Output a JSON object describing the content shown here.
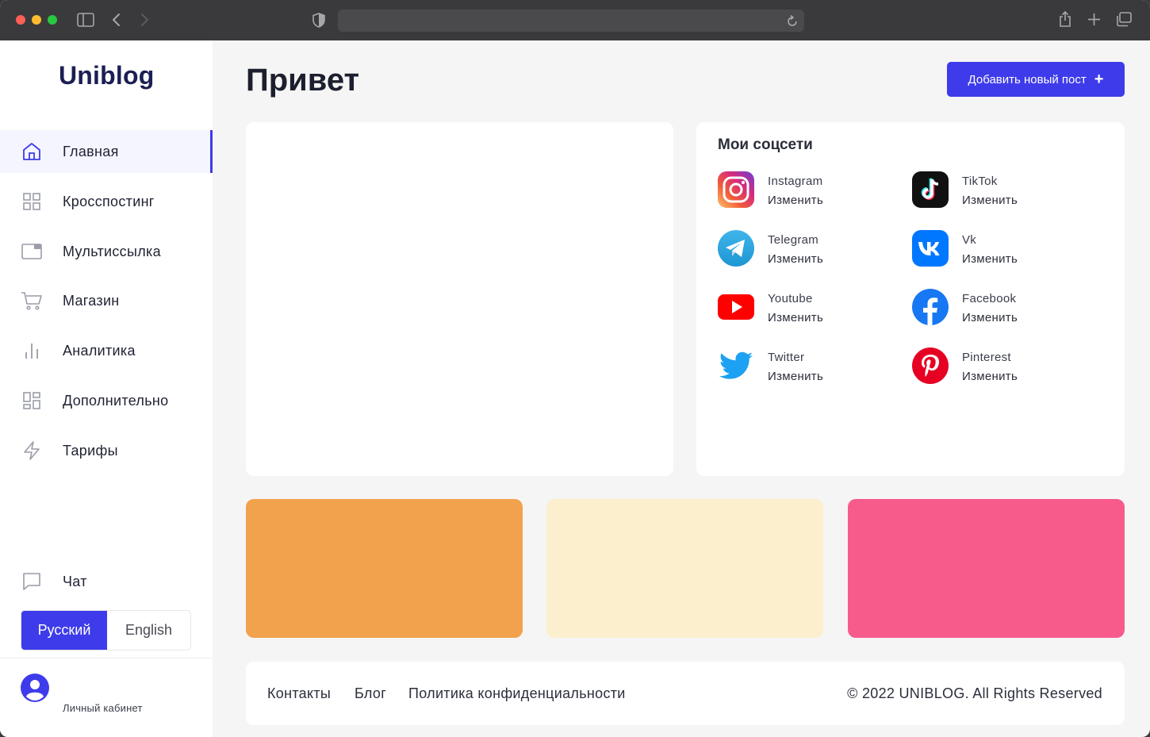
{
  "browser": {
    "window_controls": [
      "close",
      "minimize",
      "maximize"
    ],
    "icons": [
      "sidebar-toggle-icon",
      "back-icon",
      "forward-icon",
      "shield-icon",
      "reload-icon",
      "share-icon",
      "new-tab-icon",
      "tabs-overview-icon"
    ]
  },
  "sidebar": {
    "logo": "Uniblog",
    "items": [
      {
        "label": "Главная",
        "icon": "home-icon",
        "active": true
      },
      {
        "label": "Кросспостинг",
        "icon": "grid-icon"
      },
      {
        "label": "Мультиссылка",
        "icon": "browser-window-icon"
      },
      {
        "label": "Магазин",
        "icon": "cart-icon"
      },
      {
        "label": "Аналитика",
        "icon": "bar-chart-icon"
      },
      {
        "label": "Дополнительно",
        "icon": "dashboard-icon"
      },
      {
        "label": "Тарифы",
        "icon": "lightning-icon"
      }
    ],
    "chat": {
      "label": "Чат",
      "icon": "chat-icon"
    },
    "languages": {
      "ru": "Русский",
      "en": "English",
      "selected": "ru"
    },
    "account": {
      "label": "Личный кабинет",
      "icon": "user-avatar-icon"
    }
  },
  "main": {
    "title": "Привет",
    "add_post_label": "Добавить новый пост",
    "social": {
      "title": "Мои соцсети",
      "edit_label": "Изменить",
      "items": [
        {
          "name": "Instagram",
          "icon": "instagram-icon"
        },
        {
          "name": "TikTok",
          "icon": "tiktok-icon"
        },
        {
          "name": "Telegram",
          "icon": "telegram-icon"
        },
        {
          "name": "Vk",
          "icon": "vk-icon"
        },
        {
          "name": "Youtube",
          "icon": "youtube-icon"
        },
        {
          "name": "Facebook",
          "icon": "facebook-icon"
        },
        {
          "name": "Twitter",
          "icon": "twitter-icon"
        },
        {
          "name": "Pinterest",
          "icon": "pinterest-icon"
        }
      ]
    },
    "tiles": [
      {
        "color": "#f2a24d"
      },
      {
        "color": "#fcefcd"
      },
      {
        "color": "#f75b8c"
      }
    ]
  },
  "footer": {
    "links": [
      "Контакты",
      "Блог",
      "Политика конфиденциальности"
    ],
    "copyright": "© 2022 UNIBLOG. All Rights Reserved"
  },
  "colors": {
    "accent": "#3e3bea",
    "logo": "#1b1f53"
  }
}
